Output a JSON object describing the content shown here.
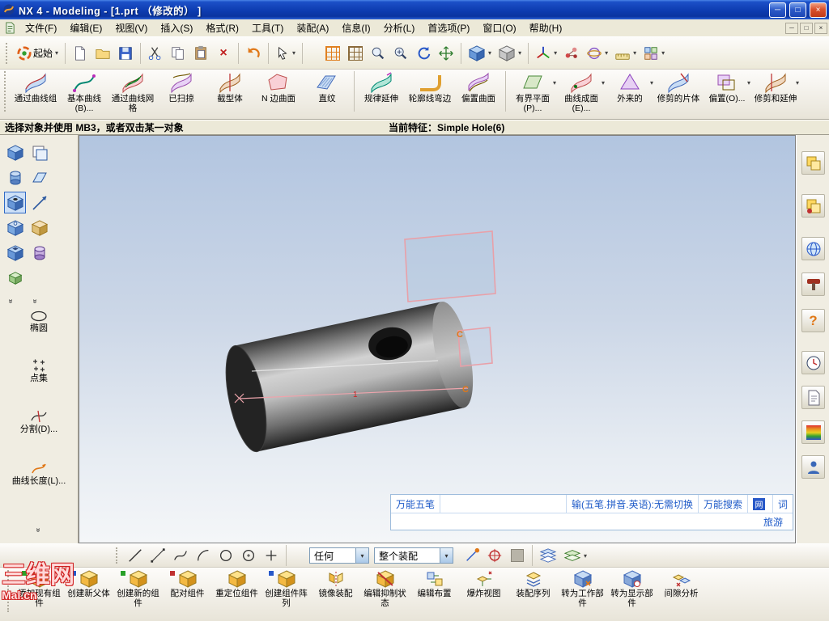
{
  "window": {
    "title": "NX 4 - Modeling - [1.prt （修改的） ]"
  },
  "icons": {
    "dropdown": "▾",
    "minimize": "─",
    "maximize": "□",
    "close": "×",
    "overflow": "»",
    "help": "?",
    "delete": "×",
    "web_glyph": "网"
  },
  "menubar": {
    "items": [
      "文件(F)",
      "编辑(E)",
      "视图(V)",
      "插入(S)",
      "格式(R)",
      "工具(T)",
      "装配(A)",
      "信息(I)",
      "分析(L)",
      "首选项(P)",
      "窗口(O)",
      "帮助(H)"
    ]
  },
  "toolbar_std": {
    "start_label": "起始"
  },
  "feature_toolbar": {
    "items": [
      "通过曲线组",
      "基本曲线(B)...",
      "通过曲线网格",
      "已扫掠",
      "截型体",
      "N 边曲面",
      "直纹",
      "规律延伸",
      "轮廓线弯边",
      "偏置曲面",
      "有界平面(P)...",
      "曲线成面(E)...",
      "外来的",
      "修剪的片体",
      "偏置(O)...",
      "修剪和延伸"
    ]
  },
  "prompt_bar": {
    "message": "选择对象并使用 MB3，或者双击某一对象",
    "current_feature": "当前特征：Simple Hole(6)"
  },
  "left_panel": {
    "tools": [
      "椭圆",
      "点集",
      "分割(D)...",
      "曲线长度(L)..."
    ]
  },
  "viewport": {
    "labels": {
      "c_top": "C",
      "c_bottom": "C",
      "sketch_num": "1"
    }
  },
  "ime_bar": {
    "name": "万能五笔",
    "status": "输(五笔.拼音.英语):无需切换",
    "search": "万能搜索",
    "web": "网",
    "dict": "词",
    "extra": "旅游"
  },
  "snap_toolbar": {
    "filter_value": "任何",
    "scope_value": "整个装配"
  },
  "assembly_toolbar": {
    "items": [
      "添加现有组件",
      "创建新父体",
      "创建新的组件",
      "配对组件",
      "重定位组件",
      "创建组件阵列",
      "镜像装配",
      "编辑抑制状态",
      "编辑布置",
      "爆炸视图",
      "装配序列",
      "转为工作部件",
      "转为显示部件",
      "间隙分析"
    ]
  },
  "watermark": {
    "line1": "三维网",
    "line2": "Mal.cn"
  },
  "colors": {
    "titlebar_blue": "#0d3cb0",
    "selection_pink": "#e9a0a8",
    "ime_text": "#1e5ac8",
    "viewport_top": "#b2c5e0"
  }
}
